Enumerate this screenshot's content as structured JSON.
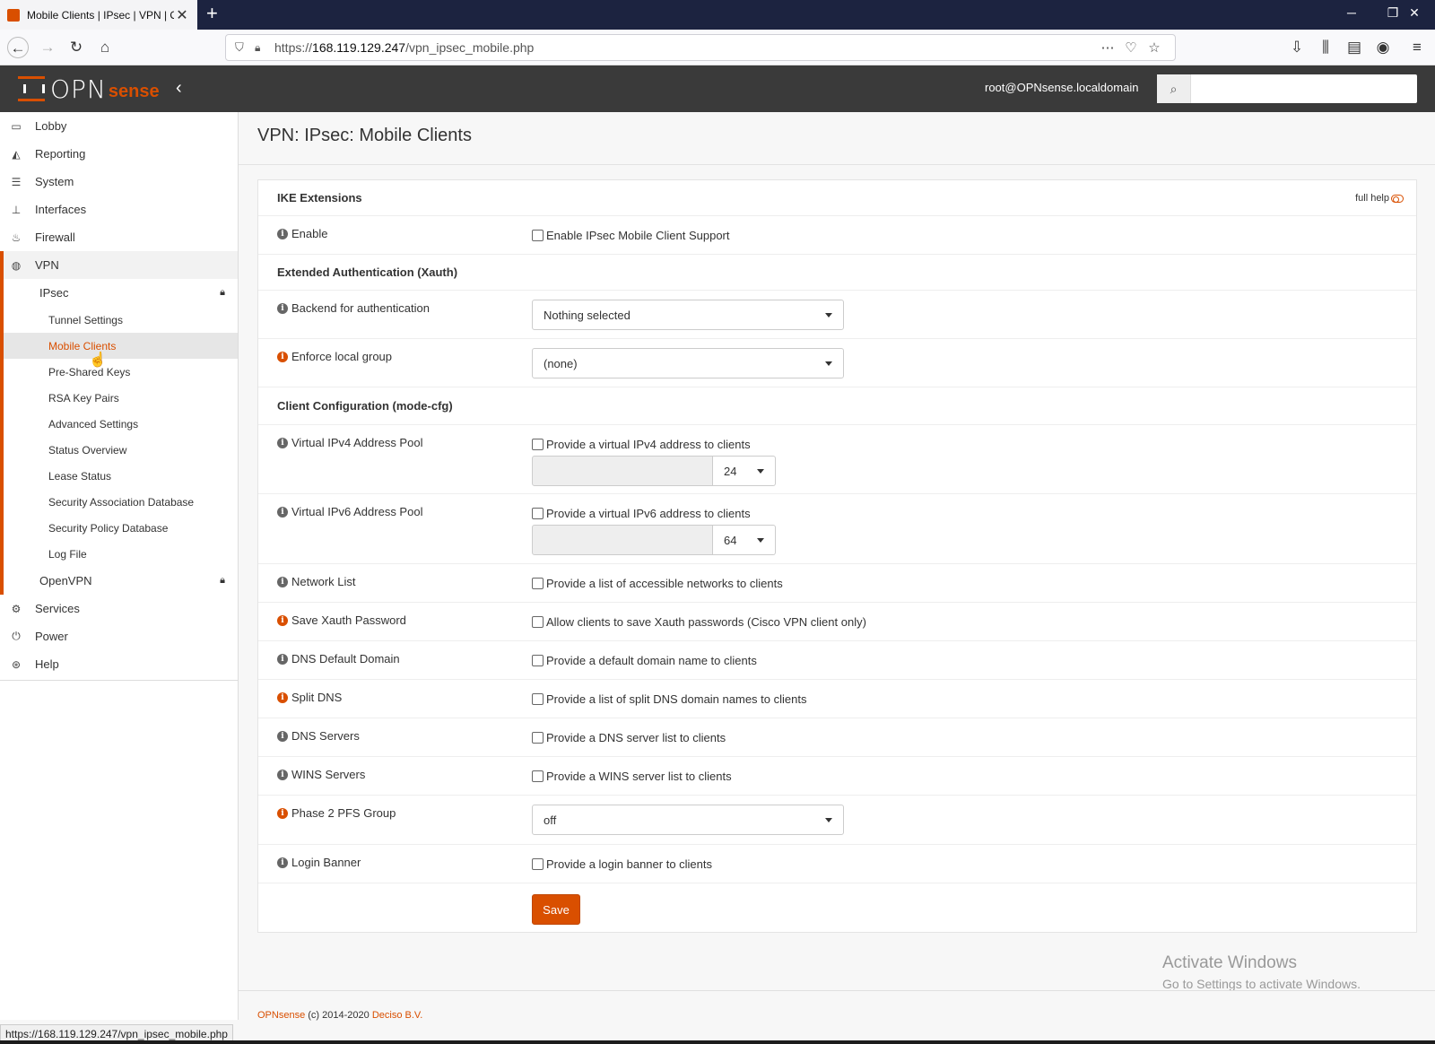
{
  "browser": {
    "tab_title": "Mobile Clients | IPsec | VPN | OPNsense",
    "url_prefix": "https://",
    "url_host": "168.119.129.247",
    "url_path": "/vpn_ipsec_mobile.php",
    "status_url": "https://168.119.129.247/vpn_ipsec_mobile.php"
  },
  "header": {
    "logo_left": "OPN",
    "logo_right": "sense",
    "user": "root@OPNsense.localdomain",
    "search_placeholder": ""
  },
  "sidebar": {
    "items": [
      {
        "label": "Lobby",
        "icon": "laptop-icon"
      },
      {
        "label": "Reporting",
        "icon": "chart-icon"
      },
      {
        "label": "System",
        "icon": "server-icon"
      },
      {
        "label": "Interfaces",
        "icon": "sitemap-icon"
      },
      {
        "label": "Firewall",
        "icon": "fire-icon"
      },
      {
        "label": "VPN",
        "icon": "globe-icon"
      }
    ],
    "vpn_sub": {
      "ipsec": "IPsec",
      "ipsec_children": [
        "Tunnel Settings",
        "Mobile Clients",
        "Pre-Shared Keys",
        "RSA Key Pairs",
        "Advanced Settings",
        "Status Overview",
        "Lease Status",
        "Security Association Database",
        "Security Policy Database",
        "Log File"
      ],
      "openvpn": "OpenVPN"
    },
    "items_after": [
      {
        "label": "Services",
        "icon": "cog-icon"
      },
      {
        "label": "Power",
        "icon": "plug-icon"
      },
      {
        "label": "Help",
        "icon": "lifebuoy-icon"
      }
    ]
  },
  "page": {
    "title": "VPN: IPsec: Mobile Clients",
    "full_help": "full help",
    "sections": {
      "ike": "IKE Extensions",
      "xauth": "Extended Authentication (Xauth)",
      "modecfg": "Client Configuration (mode-cfg)"
    },
    "fields": {
      "enable": {
        "label": "Enable",
        "text": "Enable IPsec Mobile Client Support"
      },
      "backend": {
        "label": "Backend for authentication",
        "value": "Nothing selected"
      },
      "local_group": {
        "label": "Enforce local group",
        "value": "(none)"
      },
      "ipv4_pool": {
        "label": "Virtual IPv4 Address Pool",
        "text": "Provide a virtual IPv4 address to clients",
        "mask": "24"
      },
      "ipv6_pool": {
        "label": "Virtual IPv6 Address Pool",
        "text": "Provide a virtual IPv6 address to clients",
        "mask": "64"
      },
      "network_list": {
        "label": "Network List",
        "text": "Provide a list of accessible networks to clients"
      },
      "save_xauth": {
        "label": "Save Xauth Password",
        "text": "Allow clients to save Xauth passwords (Cisco VPN client only)"
      },
      "dns_domain": {
        "label": "DNS Default Domain",
        "text": "Provide a default domain name to clients"
      },
      "split_dns": {
        "label": "Split DNS",
        "text": "Provide a list of split DNS domain names to clients"
      },
      "dns_servers": {
        "label": "DNS Servers",
        "text": "Provide a DNS server list to clients"
      },
      "wins_servers": {
        "label": "WINS Servers",
        "text": "Provide a WINS server list to clients"
      },
      "pfs_group": {
        "label": "Phase 2 PFS Group",
        "value": "off"
      },
      "login_banner": {
        "label": "Login Banner",
        "text": "Provide a login banner to clients"
      }
    },
    "save_label": "Save"
  },
  "footer": {
    "brand": "OPNsense",
    "copyright": " (c) 2014-2020 ",
    "company": "Deciso B.V."
  },
  "watermark": {
    "line1": "Activate Windows",
    "line2": "Go to Settings to activate Windows."
  },
  "colors": {
    "accent": "#d94f00",
    "header_bg": "#3a3a3a",
    "tabbar_bg": "#1c2340"
  }
}
